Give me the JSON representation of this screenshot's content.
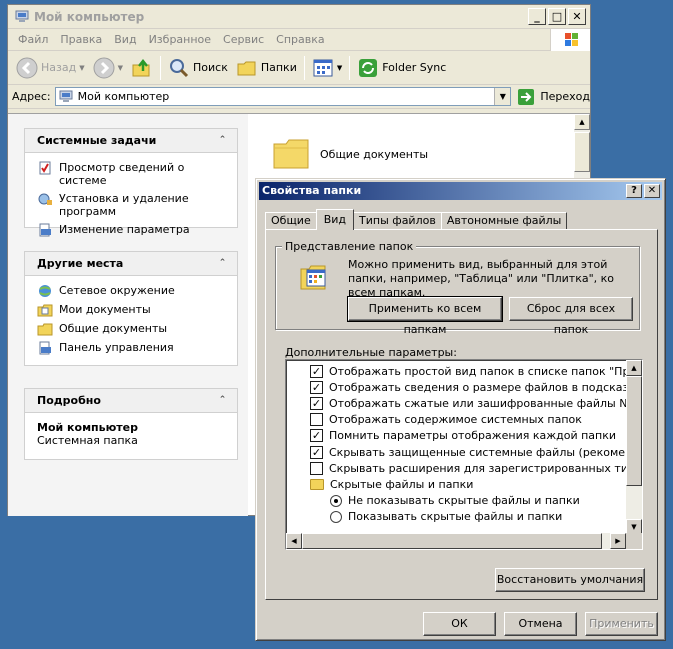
{
  "explorer": {
    "title": "Мой компьютер",
    "menu": [
      "Файл",
      "Правка",
      "Вид",
      "Избранное",
      "Сервис",
      "Справка"
    ],
    "toolbar": {
      "back": "Назад",
      "search": "Поиск",
      "folders": "Папки",
      "folder_sync": "Folder Sync"
    },
    "address": {
      "label": "Адрес:",
      "value": "Мой компьютер",
      "go": "Переход"
    },
    "system_tasks": {
      "header": "Системные задачи",
      "items": [
        "Просмотр сведений о системе",
        "Установка и удаление программ",
        "Изменение параметра"
      ]
    },
    "other_places": {
      "header": "Другие места",
      "items": [
        "Сетевое окружение",
        "Мои документы",
        "Общие документы",
        "Панель управления"
      ]
    },
    "details": {
      "header": "Подробно",
      "name": "Мой компьютер",
      "type": "Системная папка"
    },
    "content": {
      "item": "Общие документы"
    }
  },
  "dialog": {
    "title": "Свойства папки",
    "tabs": [
      "Общие",
      "Вид",
      "Типы файлов",
      "Автономные файлы"
    ],
    "active_tab": "Вид",
    "folder_views": {
      "label": "Представление папок",
      "text": "Можно применить вид, выбранный для этой папки, например, \"Таблица\" или \"Плитка\", ко всем папкам.",
      "apply_all": "Применить ко всем папкам",
      "reset_all": "Сброс для всех папок"
    },
    "advanced": {
      "label": "Дополнительные параметры:",
      "items": [
        {
          "kind": "checkbox",
          "checked": true,
          "text": "Отображать простой вид папок в списке папок \"Проводни"
        },
        {
          "kind": "checkbox",
          "checked": true,
          "text": "Отображать сведения о размере файлов в подсказках па"
        },
        {
          "kind": "checkbox",
          "checked": true,
          "text": "Отображать сжатые или зашифрованные файлы NTFS др"
        },
        {
          "kind": "checkbox",
          "checked": false,
          "text": "Отображать содержимое системных папок"
        },
        {
          "kind": "checkbox",
          "checked": true,
          "text": "Помнить параметры отображения каждой папки"
        },
        {
          "kind": "checkbox",
          "checked": true,
          "text": "Скрывать защищенные системные файлы (рекомендуется"
        },
        {
          "kind": "checkbox",
          "checked": false,
          "text": "Скрывать расширения для зарегистрированных типов фа"
        },
        {
          "kind": "folder",
          "text": "Скрытые файлы и папки"
        },
        {
          "kind": "radio",
          "checked": true,
          "text": "Не показывать скрытые файлы и папки"
        },
        {
          "kind": "radio",
          "checked": false,
          "text": "Показывать скрытые файлы и папки"
        }
      ],
      "restore_defaults": "Восстановить умолчания"
    },
    "buttons": {
      "ok": "ОК",
      "cancel": "Отмена",
      "apply": "Применить"
    }
  },
  "colors": {
    "desktop": "#3a6ea5",
    "dialog_title_start": "#0a246a",
    "dialog_title_end": "#a6caf0"
  }
}
